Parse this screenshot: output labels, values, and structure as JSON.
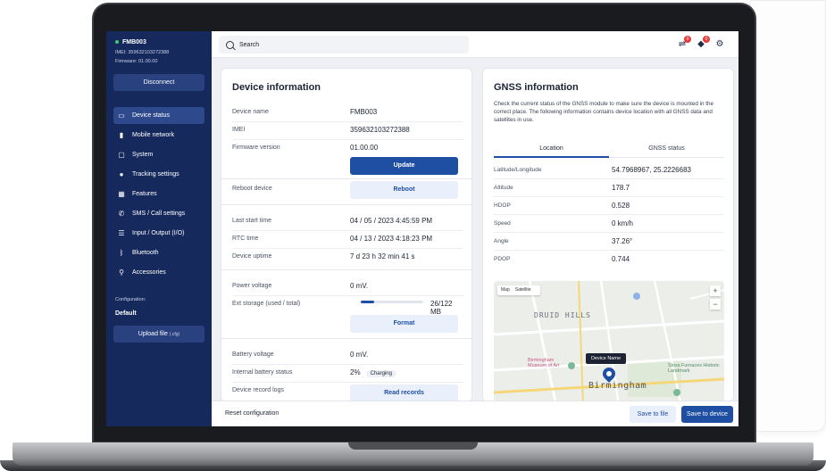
{
  "sidebar": {
    "device_name": "FMB003",
    "imei": "IMEI: 359632103272388",
    "firmware": "Firmware: 01.00.00",
    "disconnect_label": "Disconnect",
    "items": [
      {
        "label": "Device status",
        "icon": "monitor-icon"
      },
      {
        "label": "Mobile network",
        "icon": "signal-bars-icon"
      },
      {
        "label": "System",
        "icon": "system-icon"
      },
      {
        "label": "Tracking settings",
        "icon": "location-pin-icon"
      },
      {
        "label": "Features",
        "icon": "grid-icon"
      },
      {
        "label": "SMS / Call settings",
        "icon": "phone-icon"
      },
      {
        "label": "Input / Output (I/O)",
        "icon": "io-sliders-icon"
      },
      {
        "label": "Bluetooth",
        "icon": "bluetooth-icon"
      },
      {
        "label": "Accessories",
        "icon": "accessories-icon"
      }
    ],
    "configuration_label": "Configuration:",
    "configuration_value": "Default",
    "upload_label": "Upload file",
    "upload_ext": "(.cfg)"
  },
  "topbar": {
    "search_placeholder": "Search",
    "badge_count_1": "0",
    "badge_count_2": "0"
  },
  "device_info": {
    "title": "Device information",
    "device_name_label": "Device name",
    "device_name_value": "FMB003",
    "imei_label": "IMEI",
    "imei_value": "359632103272388",
    "firmware_label": "Firmware version",
    "firmware_value": "01.00.00",
    "update_label": "Update",
    "reboot_label": "Reboot device",
    "reboot_button": "Reboot",
    "last_start_label": "Last start time",
    "last_start_value": "04 / 05 / 2023  4:45:59 PM",
    "rtc_label": "RTC time",
    "rtc_value": "04 / 13 / 2023  4:18:23 PM",
    "uptime_label": "Device uptime",
    "uptime_value": "7 d 23 h 32 min 41 s",
    "power_label": "Power voltage",
    "power_value": "0 mV.",
    "storage_label": "Ext storage (used / total)",
    "storage_value": "26/122 MB",
    "storage_fraction": 0.21,
    "format_label": "Format",
    "battery_label": "Battery voltage",
    "battery_value": "0 mV.",
    "internal_battery_label": "Internal battery status",
    "internal_battery_value": "2%",
    "charging_label": "Charging",
    "records_label": "Device record logs",
    "records_button": "Read records"
  },
  "gnss": {
    "title": "GNSS information",
    "description": "Check the current status of the GNSS module to make sure the device is mounted in the correct place. The following information contains device location with all GNSS data and satellites in use.",
    "tab_location": "Location",
    "tab_status": "GNSS status",
    "rows": [
      {
        "label": "Latitude/Longitude",
        "value": "54.7968967, 25.2226683"
      },
      {
        "label": "Altitude",
        "value": "178.7"
      },
      {
        "label": "HDOP",
        "value": "0.528"
      },
      {
        "label": "Speed",
        "value": "0 km/h"
      },
      {
        "label": "Angle",
        "value": "37.26°"
      },
      {
        "label": "PDOP",
        "value": "0.744"
      }
    ],
    "map": {
      "map_label": "Map",
      "satellite_label": "Satellite",
      "zoom_in": "+",
      "zoom_out": "−",
      "area_1": "DRUID HILLS",
      "area_2": "Birmingham",
      "museum": "Birmingham Museum of Art",
      "sloss": "Sloss Furnaces Historic Landmark",
      "pin_label": "Device Name"
    }
  },
  "footer": {
    "reset_label": "Reset configuration",
    "save_file_label": "Save to file",
    "save_device_label": "Save to device"
  }
}
